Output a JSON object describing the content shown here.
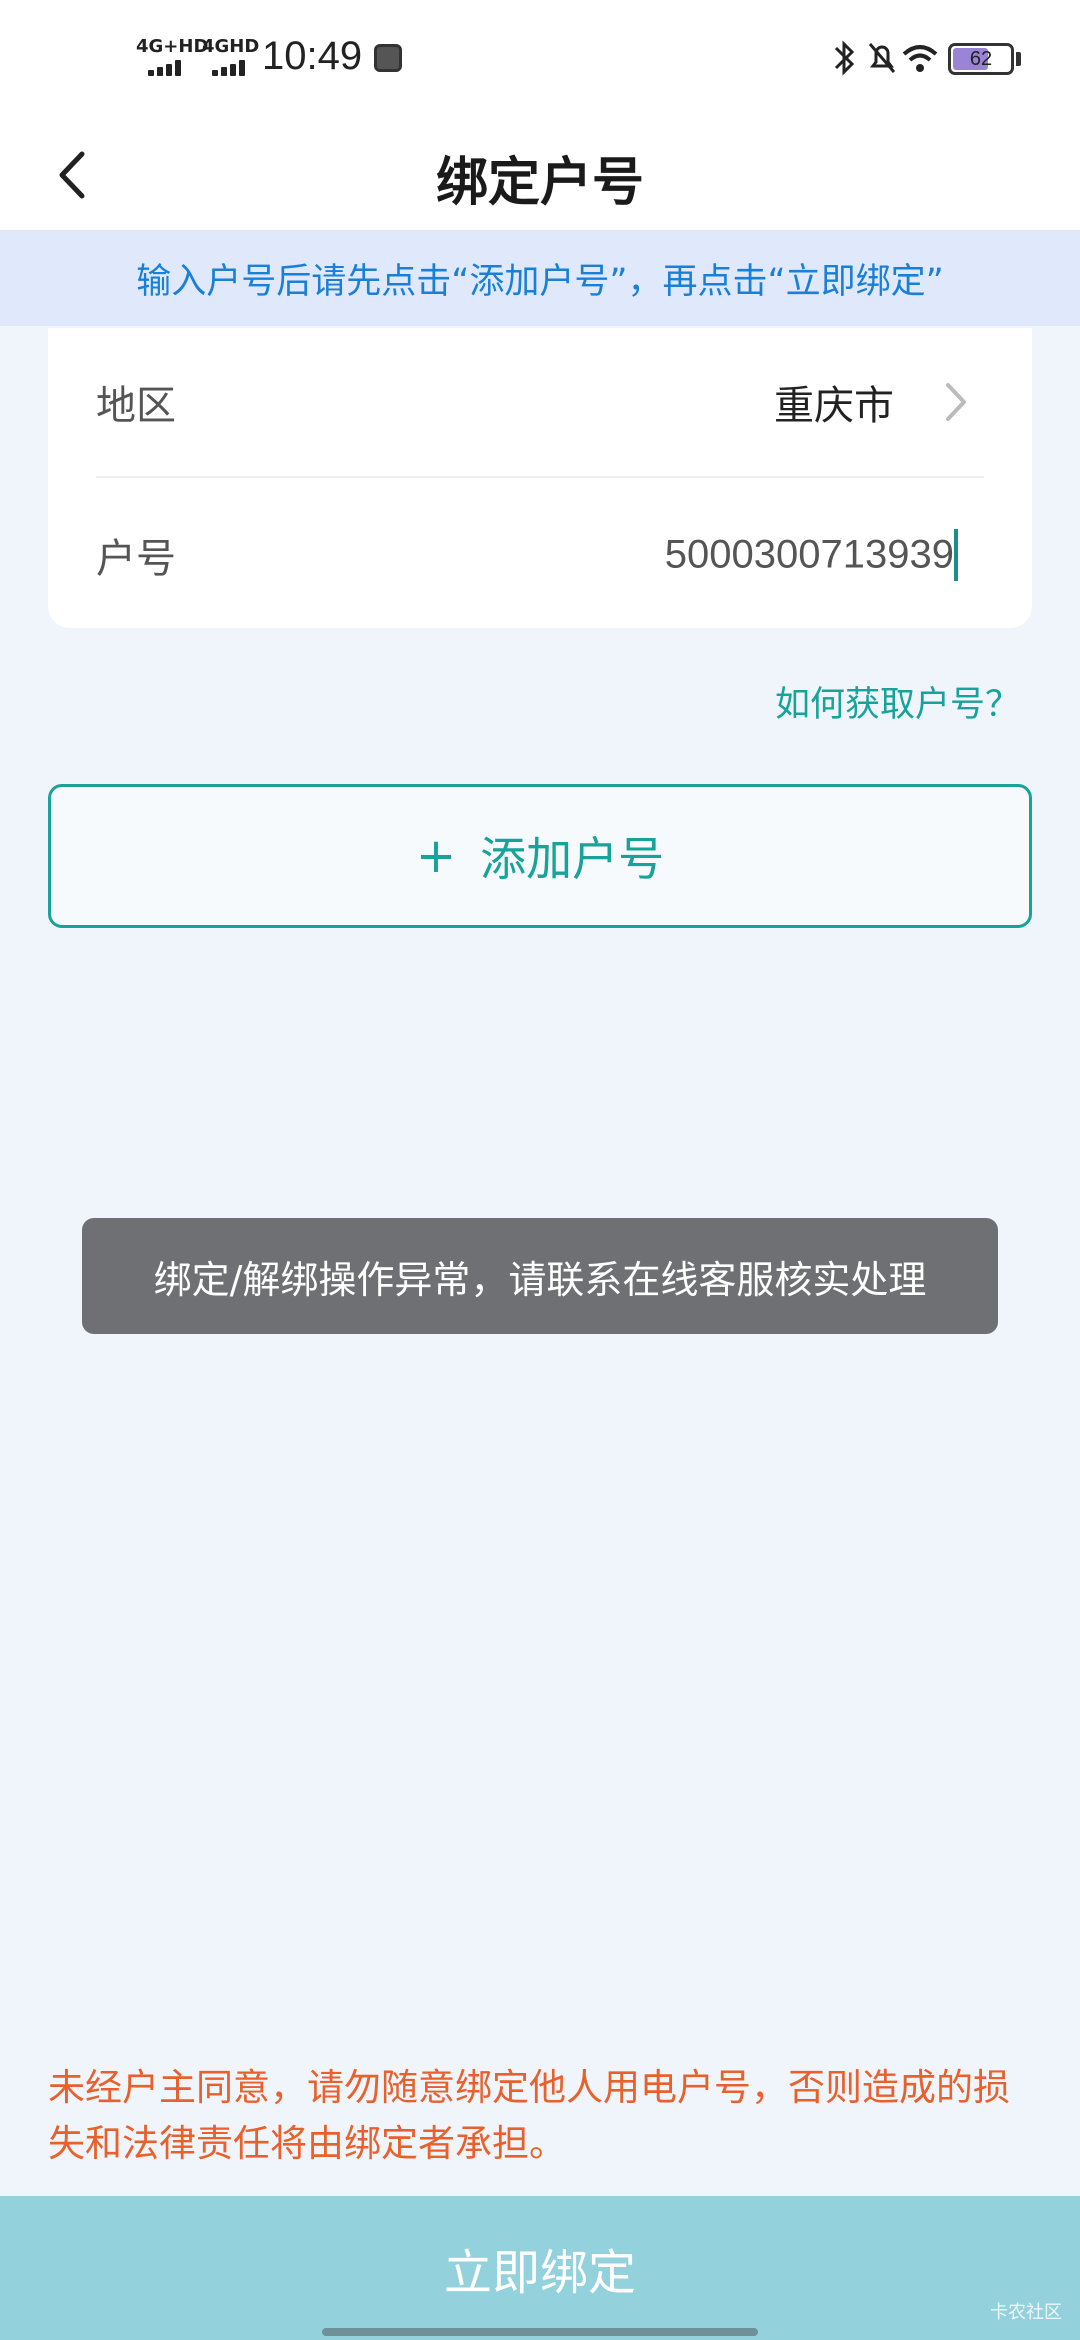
{
  "status_bar": {
    "network1": "4G+HD",
    "network2": "4GHD",
    "time": "10:49",
    "battery": "62",
    "battery_level": 0.62
  },
  "header": {
    "title": "绑定户号"
  },
  "hint": "输入户号后请先点击“添加户号”，再点击“立即绑定”",
  "form": {
    "region_label": "地区",
    "region_value": "重庆市",
    "account_label": "户号",
    "account_value": "5000300713939"
  },
  "help_link": "如何获取户号？",
  "add_button": {
    "plus": "+",
    "label": "添加户号"
  },
  "toast": "绑定/解绑操作异常，请联系在线客服核实处理",
  "warning": "未经户主同意，请勿随意绑定他人用电户号，否则造成的损失和法律责任将由绑定者承担。",
  "bind_button": "立即绑定",
  "watermark": "卡农社区",
  "colors": {
    "accent": "#17a29a",
    "hint_text": "#1a7fd6",
    "warning": "#e8612c",
    "bind_button": "#93d1dc"
  }
}
